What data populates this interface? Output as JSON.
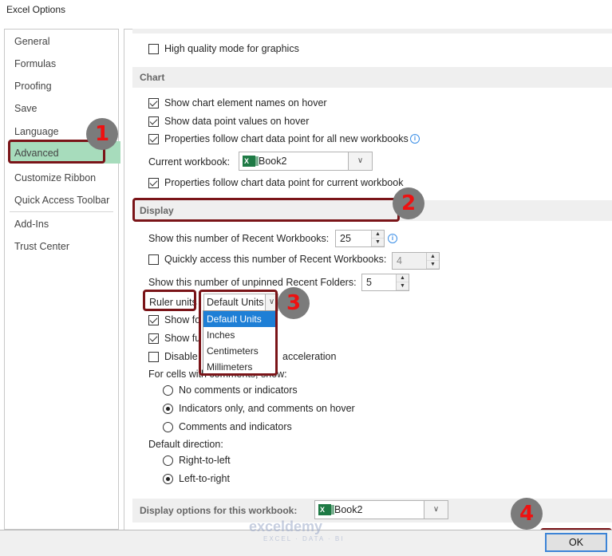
{
  "window": {
    "title": "Excel Options"
  },
  "sidebar": {
    "items": [
      {
        "label": "General"
      },
      {
        "label": "Formulas"
      },
      {
        "label": "Proofing"
      },
      {
        "label": "Save"
      },
      {
        "label": "Language"
      },
      {
        "label": "Advanced",
        "selected": true
      },
      {
        "label": "Customize Ribbon"
      },
      {
        "label": "Quick Access Toolbar"
      },
      {
        "label": "Add-Ins"
      },
      {
        "label": "Trust Center"
      }
    ]
  },
  "content": {
    "high_quality": {
      "label": "High quality mode for graphics",
      "checked": false
    },
    "chart": {
      "header": "Chart",
      "show_element_names": {
        "label": "Show chart element names on hover",
        "checked": true
      },
      "show_point_values": {
        "label": "Show data point values on hover",
        "checked": true
      },
      "props_all_new": {
        "label": "Properties follow chart data point for all new workbooks",
        "checked": true
      },
      "current_workbook_label": "Current workbook:",
      "current_workbook_value": "Book2",
      "props_current": {
        "label": "Properties follow chart data point for current workbook",
        "checked": true
      }
    },
    "display": {
      "header": "Display",
      "recent_workbooks_label": "Show this number of Recent Workbooks:",
      "recent_workbooks_value": "25",
      "quick_access": {
        "label": "Quickly access this number of Recent Workbooks:",
        "checked": false,
        "value": "4"
      },
      "recent_folders_label": "Show this number of unpinned Recent Folders:",
      "recent_folders_value": "5",
      "ruler_units_label": "Ruler units",
      "ruler_units_value": "Default Units",
      "ruler_options": [
        "Default Units",
        "Inches",
        "Centimeters",
        "Millimeters"
      ],
      "show_fo": {
        "label": "Show fo",
        "checked": true
      },
      "show_fu": {
        "label": "Show fu",
        "checked": true
      },
      "disable": {
        "label_start": "Disable",
        "label_end": "acceleration",
        "checked": false
      },
      "comments_label": "For cells with comments, show:",
      "comments_options": [
        {
          "label": "No comments or indicators",
          "checked": false
        },
        {
          "label": "Indicators only, and comments on hover",
          "checked": true
        },
        {
          "label": "Comments and indicators",
          "checked": false
        }
      ],
      "direction_label": "Default direction:",
      "direction_options": [
        {
          "label": "Right-to-left",
          "checked": false
        },
        {
          "label": "Left-to-right",
          "checked": true
        }
      ]
    },
    "workbook_display": {
      "label": "Display options for this workbook:",
      "value": "Book2"
    }
  },
  "footer": {
    "ok_label": "OK"
  },
  "annotations": [
    "1",
    "2",
    "3",
    "4"
  ],
  "watermark": {
    "brand": "exceldemy",
    "tagline": "EXCEL · DATA · BI"
  },
  "colors": {
    "selected_nav": "#a7dcbc",
    "highlight_box": "#7a1418",
    "dropdown_selected": "#1e7fd6"
  }
}
